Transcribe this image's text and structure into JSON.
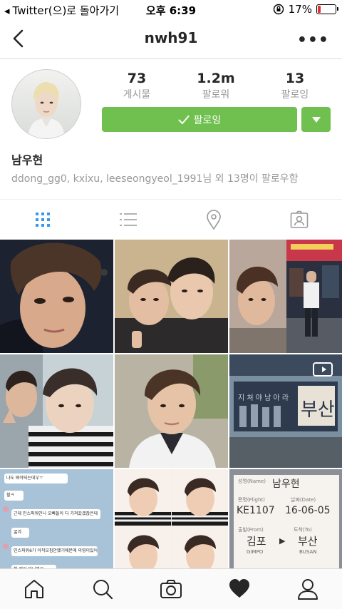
{
  "status_bar": {
    "back_app": "Twitter(으)로 돌아가기",
    "time": "오후 6:39",
    "battery": "17%",
    "battery_level": 0.17
  },
  "nav": {
    "title": "nwh91",
    "back_icon": "chevron-left-icon",
    "more_icon": "more-horizontal-icon"
  },
  "profile": {
    "stats": [
      {
        "value": "73",
        "label": "게시물"
      },
      {
        "value": "1.2m",
        "label": "팔로워"
      },
      {
        "value": "13",
        "label": "팔로잉"
      }
    ],
    "follow_label": "팔로잉",
    "name": "남우현",
    "followed_by": "ddong_gg0, kxixu, leeseongyeol_1991님 외 13명이 팔로우함"
  },
  "tabs": [
    {
      "icon": "grid-icon",
      "active": true
    },
    {
      "icon": "list-icon",
      "active": false
    },
    {
      "icon": "location-pin-icon",
      "active": false
    },
    {
      "icon": "tagged-person-icon",
      "active": false
    }
  ],
  "grid_tiles": [
    {
      "kind": "selfie"
    },
    {
      "kind": "two-person selfie"
    },
    {
      "kind": "selfie and city street"
    },
    {
      "kind": "two-person selfie"
    },
    {
      "kind": "selfie"
    },
    {
      "kind": "video of bus advertisement",
      "badge": "video-icon"
    },
    {
      "kind": "chat screenshot"
    },
    {
      "kind": "selfie collage"
    },
    {
      "kind": "boarding pass"
    }
  ],
  "chat_tile": {
    "messages": [
      "나도 봐야되는데우ㅜ",
      "헐ㅋ",
      "근데 인스파워인니 오빠들이 다 가져갔겠잖은데",
      "굶겨",
      "인스파워6기 아직모집안했기때문에 의영이있어",
      "청 제이 있니까요"
    ]
  },
  "boarding_tile": {
    "name_label": "성명(Name)",
    "name": "남우현",
    "flight_label": "편명(Flight)",
    "flight": "KE1107",
    "date_label": "날짜(Date)",
    "date": "16-06-05",
    "from_label": "출발(From)",
    "from": "김포",
    "from_en": "GIMPO",
    "to_label": "도착(To)",
    "to": "부산",
    "to_en": "BUSAN"
  },
  "bus_tile": {
    "text": "지 쳐 야 남 아 라"
  },
  "bottom_nav": [
    {
      "icon": "home-icon"
    },
    {
      "icon": "search-icon"
    },
    {
      "icon": "camera-icon"
    },
    {
      "icon": "heart-icon",
      "active": true
    },
    {
      "icon": "profile-icon"
    }
  ],
  "colors": {
    "accent_green": "#70c050",
    "active_tab_blue": "#3897f0",
    "battery_red": "#e0302f"
  }
}
